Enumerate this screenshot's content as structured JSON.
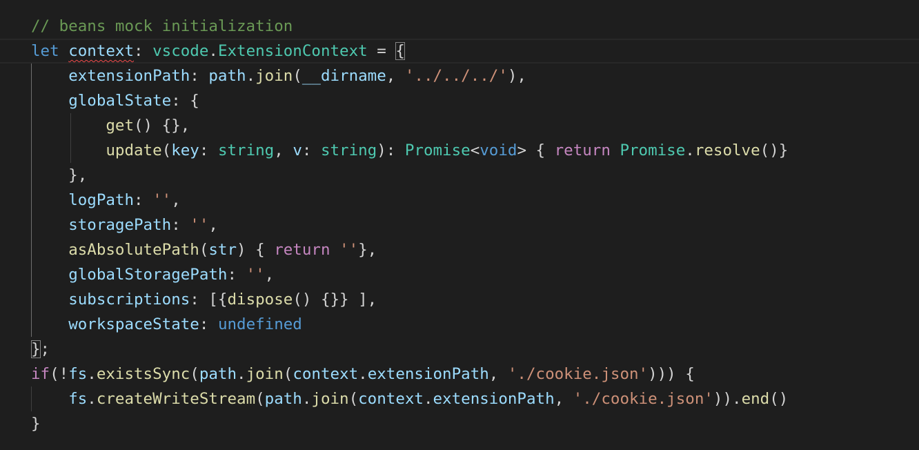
{
  "editor": {
    "language": "typescript",
    "colors": {
      "background": "#1e1e1e",
      "comment": "#6a9955",
      "keyword": "#569cd6",
      "control": "#c586c0",
      "variable": "#9cdcfe",
      "type": "#4ec9b0",
      "function": "#dcdcaa",
      "string": "#ce9178",
      "punctuation": "#d4d4d4",
      "error_squiggle": "#f14c4c"
    },
    "lines": [
      [
        {
          "t": "// beans mock initialization",
          "c": "comment"
        }
      ],
      [
        {
          "t": "let",
          "c": "keyword"
        },
        {
          "t": " ",
          "c": "punct"
        },
        {
          "t": "context",
          "c": "variable",
          "squiggle": true
        },
        {
          "t": ": ",
          "c": "punct"
        },
        {
          "t": "vscode",
          "c": "type"
        },
        {
          "t": ".",
          "c": "punct"
        },
        {
          "t": "ExtensionContext",
          "c": "type"
        },
        {
          "t": " = ",
          "c": "op"
        },
        {
          "t": "{",
          "c": "punct",
          "bracket": true
        }
      ],
      [
        {
          "t": "    ",
          "c": "punct"
        },
        {
          "t": "extensionPath",
          "c": "property"
        },
        {
          "t": ": ",
          "c": "punct"
        },
        {
          "t": "path",
          "c": "variable"
        },
        {
          "t": ".",
          "c": "punct"
        },
        {
          "t": "join",
          "c": "function"
        },
        {
          "t": "(",
          "c": "punct"
        },
        {
          "t": "__dirname",
          "c": "variable"
        },
        {
          "t": ", ",
          "c": "punct"
        },
        {
          "t": "'../../../'",
          "c": "string"
        },
        {
          "t": "),",
          "c": "punct"
        }
      ],
      [
        {
          "t": "    ",
          "c": "punct"
        },
        {
          "t": "globalState",
          "c": "property"
        },
        {
          "t": ": {",
          "c": "punct"
        }
      ],
      [
        {
          "t": "        ",
          "c": "punct"
        },
        {
          "t": "get",
          "c": "function"
        },
        {
          "t": "() {},",
          "c": "punct"
        }
      ],
      [
        {
          "t": "        ",
          "c": "punct"
        },
        {
          "t": "update",
          "c": "function"
        },
        {
          "t": "(",
          "c": "punct"
        },
        {
          "t": "key",
          "c": "param"
        },
        {
          "t": ": ",
          "c": "punct"
        },
        {
          "t": "string",
          "c": "type"
        },
        {
          "t": ", ",
          "c": "punct"
        },
        {
          "t": "v",
          "c": "param"
        },
        {
          "t": ": ",
          "c": "punct"
        },
        {
          "t": "string",
          "c": "type"
        },
        {
          "t": "): ",
          "c": "punct"
        },
        {
          "t": "Promise",
          "c": "type"
        },
        {
          "t": "<",
          "c": "punct"
        },
        {
          "t": "void",
          "c": "keyword"
        },
        {
          "t": "> { ",
          "c": "punct"
        },
        {
          "t": "return",
          "c": "control"
        },
        {
          "t": " ",
          "c": "punct"
        },
        {
          "t": "Promise",
          "c": "type"
        },
        {
          "t": ".",
          "c": "punct"
        },
        {
          "t": "resolve",
          "c": "function"
        },
        {
          "t": "()}",
          "c": "punct"
        }
      ],
      [
        {
          "t": "    },",
          "c": "punct"
        }
      ],
      [
        {
          "t": "    ",
          "c": "punct"
        },
        {
          "t": "logPath",
          "c": "property"
        },
        {
          "t": ": ",
          "c": "punct"
        },
        {
          "t": "''",
          "c": "string"
        },
        {
          "t": ",",
          "c": "punct"
        }
      ],
      [
        {
          "t": "    ",
          "c": "punct"
        },
        {
          "t": "storagePath",
          "c": "property"
        },
        {
          "t": ": ",
          "c": "punct"
        },
        {
          "t": "''",
          "c": "string"
        },
        {
          "t": ",",
          "c": "punct"
        }
      ],
      [
        {
          "t": "    ",
          "c": "punct"
        },
        {
          "t": "asAbsolutePath",
          "c": "function"
        },
        {
          "t": "(",
          "c": "punct"
        },
        {
          "t": "str",
          "c": "param"
        },
        {
          "t": ") { ",
          "c": "punct"
        },
        {
          "t": "return",
          "c": "control"
        },
        {
          "t": " ",
          "c": "punct"
        },
        {
          "t": "''",
          "c": "string"
        },
        {
          "t": "},",
          "c": "punct"
        }
      ],
      [
        {
          "t": "    ",
          "c": "punct"
        },
        {
          "t": "globalStoragePath",
          "c": "property"
        },
        {
          "t": ": ",
          "c": "punct"
        },
        {
          "t": "''",
          "c": "string"
        },
        {
          "t": ",",
          "c": "punct"
        }
      ],
      [
        {
          "t": "    ",
          "c": "punct"
        },
        {
          "t": "subscriptions",
          "c": "property"
        },
        {
          "t": ": [{",
          "c": "punct"
        },
        {
          "t": "dispose",
          "c": "function"
        },
        {
          "t": "() {}} ],",
          "c": "punct"
        }
      ],
      [
        {
          "t": "    ",
          "c": "punct"
        },
        {
          "t": "workspaceState",
          "c": "property"
        },
        {
          "t": ": ",
          "c": "punct"
        },
        {
          "t": "undefined",
          "c": "constant"
        }
      ],
      [
        {
          "t": "}",
          "c": "punct",
          "bracket": true
        },
        {
          "t": ";",
          "c": "punct"
        }
      ],
      [
        {
          "t": "if",
          "c": "control"
        },
        {
          "t": "(!",
          "c": "punct"
        },
        {
          "t": "fs",
          "c": "variable"
        },
        {
          "t": ".",
          "c": "punct"
        },
        {
          "t": "existsSync",
          "c": "function"
        },
        {
          "t": "(",
          "c": "punct"
        },
        {
          "t": "path",
          "c": "variable"
        },
        {
          "t": ".",
          "c": "punct"
        },
        {
          "t": "join",
          "c": "function"
        },
        {
          "t": "(",
          "c": "punct"
        },
        {
          "t": "context",
          "c": "variable"
        },
        {
          "t": ".",
          "c": "punct"
        },
        {
          "t": "extensionPath",
          "c": "variable"
        },
        {
          "t": ", ",
          "c": "punct"
        },
        {
          "t": "'./cookie.json'",
          "c": "string"
        },
        {
          "t": "))) {",
          "c": "punct"
        }
      ],
      [
        {
          "t": "    ",
          "c": "punct"
        },
        {
          "t": "fs",
          "c": "variable"
        },
        {
          "t": ".",
          "c": "punct"
        },
        {
          "t": "createWriteStream",
          "c": "function"
        },
        {
          "t": "(",
          "c": "punct"
        },
        {
          "t": "path",
          "c": "variable"
        },
        {
          "t": ".",
          "c": "punct"
        },
        {
          "t": "join",
          "c": "function"
        },
        {
          "t": "(",
          "c": "punct"
        },
        {
          "t": "context",
          "c": "variable"
        },
        {
          "t": ".",
          "c": "punct"
        },
        {
          "t": "extensionPath",
          "c": "variable"
        },
        {
          "t": ", ",
          "c": "punct"
        },
        {
          "t": "'./cookie.json'",
          "c": "string"
        },
        {
          "t": ")).",
          "c": "punct"
        },
        {
          "t": "end",
          "c": "function"
        },
        {
          "t": "()",
          "c": "punct"
        }
      ],
      [
        {
          "t": "}",
          "c": "punct"
        }
      ]
    ]
  }
}
